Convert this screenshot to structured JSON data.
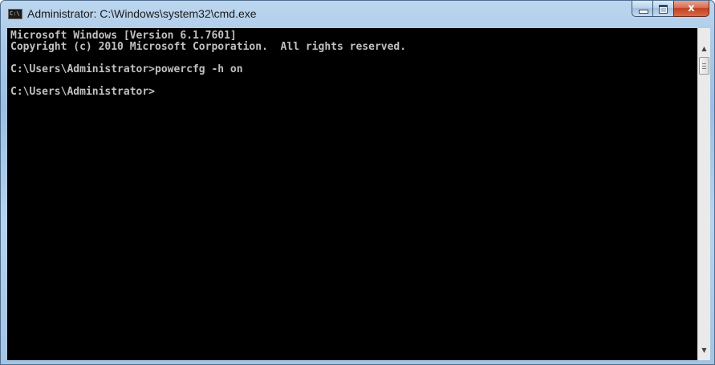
{
  "window": {
    "title": "Administrator: C:\\Windows\\system32\\cmd.exe",
    "icon": "cmd-icon",
    "icon_text": "C:\\"
  },
  "caption": {
    "minimize_icon": "minimize-icon",
    "maximize_icon": "maximize-icon",
    "close_icon": "close-icon",
    "close_glyph": "x"
  },
  "console": {
    "lines": [
      "Microsoft Windows [Version 6.1.7601]",
      "Copyright (c) 2010 Microsoft Corporation.  All rights reserved.",
      "",
      "C:\\Users\\Administrator>powercfg -h on",
      "",
      "C:\\Users\\Administrator>"
    ],
    "background": "#000000",
    "foreground": "#c0c0c0"
  },
  "scrollbar": {
    "up_glyph": "▲",
    "down_glyph": "▼"
  },
  "colors": {
    "frame": "#a9c8e6",
    "close_button": "#c4401f"
  }
}
